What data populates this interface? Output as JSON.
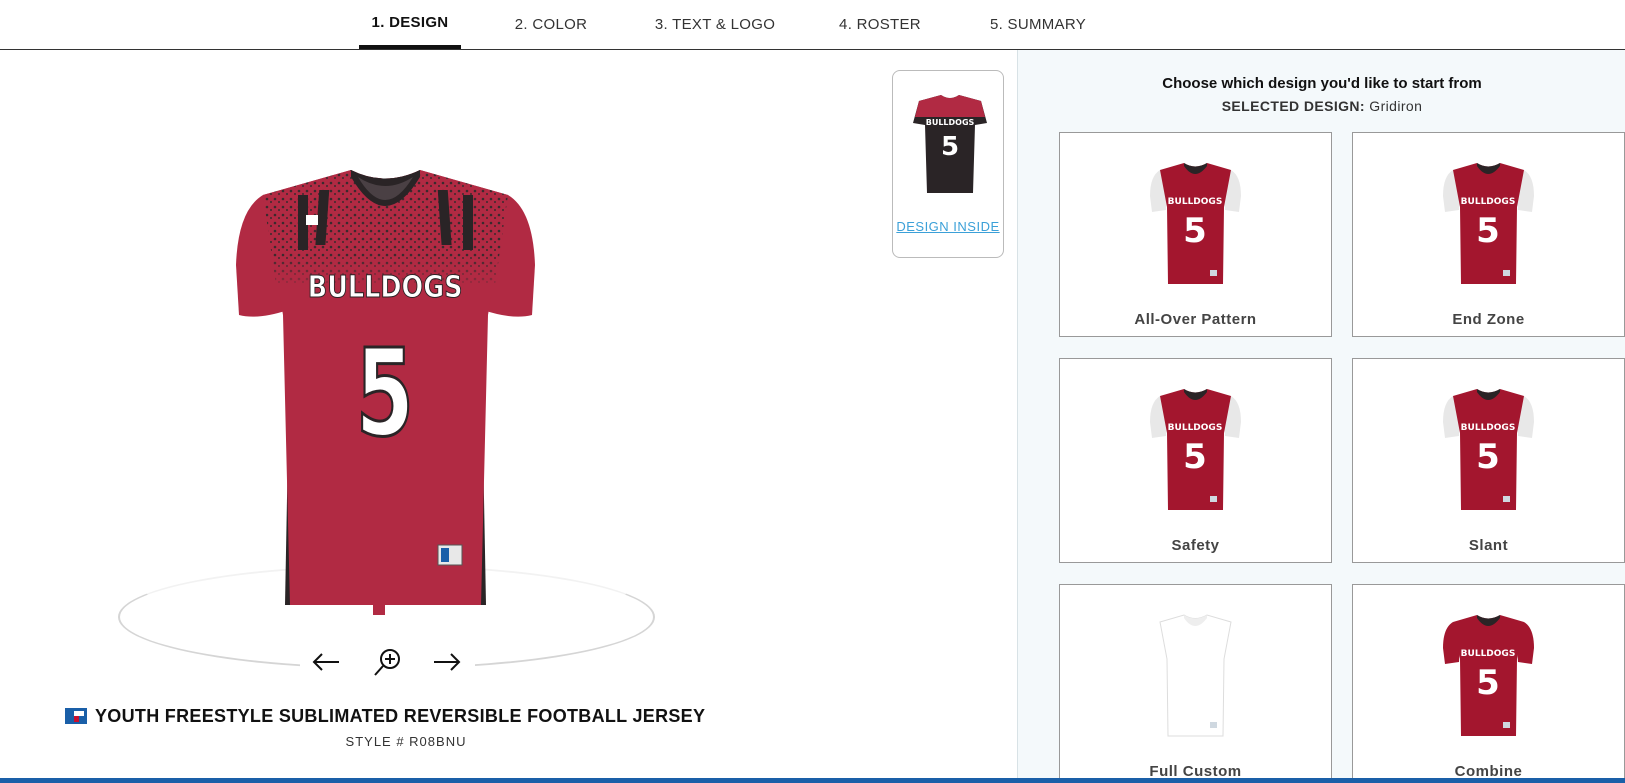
{
  "nav": {
    "tabs": [
      {
        "label": "1. DESIGN",
        "active": true
      },
      {
        "label": "2. COLOR",
        "active": false
      },
      {
        "label": "3. TEXT & LOGO",
        "active": false
      },
      {
        "label": "4. ROSTER",
        "active": false
      },
      {
        "label": "5. SUMMARY",
        "active": false
      }
    ]
  },
  "viewer": {
    "team_text": "BULLDOGS",
    "number": "5",
    "inside_link": "DESIGN INSIDE",
    "controls": [
      "arrow-left-icon",
      "zoom-in-icon",
      "arrow-right-icon"
    ]
  },
  "product": {
    "name": "YOUTH FREESTYLE SUBLIMATED REVERSIBLE FOOTBALL JERSEY",
    "style": "STYLE # R08BNU"
  },
  "panel": {
    "prompt": "Choose which design you'd like to start from",
    "selected_label": "SELECTED DESIGN:",
    "selected_value": "Gridiron",
    "designs": [
      {
        "label": "All-Over Pattern",
        "body_color": "#a3162e",
        "sleeve_color": "#e8e8e8"
      },
      {
        "label": "End Zone",
        "body_color": "#a3162e",
        "sleeve_color": "#e8e8e8"
      },
      {
        "label": "Safety",
        "body_color": "#a3162e",
        "sleeve_color": "#e8e8e8"
      },
      {
        "label": "Slant",
        "body_color": "#a3162e",
        "sleeve_color": "#e8e8e8"
      },
      {
        "label": "Full Custom",
        "body_color": "#ffffff",
        "sleeve_color": "#ffffff"
      },
      {
        "label": "Combine",
        "body_color": "#a3162e",
        "sleeve_color": "#a3162e"
      }
    ]
  },
  "colors": {
    "jersey_red": "#b12a43",
    "jersey_dark": "#2a2426",
    "link_blue": "#3ba0d8",
    "panel_bg": "#f4f9fb",
    "brand_blue": "#1a5fa8"
  }
}
